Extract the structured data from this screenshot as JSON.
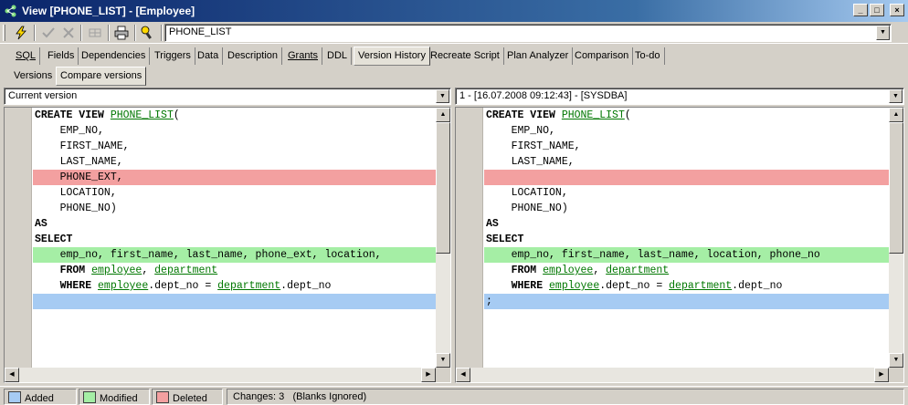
{
  "window": {
    "title": "View [PHONE_LIST] - [Employee]",
    "buttons": {
      "minimize": "_",
      "maximize": "□",
      "close": "×"
    }
  },
  "toolbar": {
    "object_name": "PHONE_LIST",
    "icons": [
      "compile-icon",
      "commit-icon",
      "rollback-icon",
      "grid-icon",
      "print-icon",
      "dependencies-icon"
    ]
  },
  "tabs": [
    {
      "label": "SQL",
      "underline": true
    },
    {
      "label": "Fields"
    },
    {
      "label": "Dependencies"
    },
    {
      "label": "Triggers"
    },
    {
      "label": "Data"
    },
    {
      "label": "Description"
    },
    {
      "label": "Grants",
      "underline": true
    },
    {
      "label": "DDL"
    },
    {
      "label": "Version History",
      "active": true
    },
    {
      "label": "Recreate Script"
    },
    {
      "label": "Plan Analyzer"
    },
    {
      "label": "Comparison"
    },
    {
      "label": "To-do"
    }
  ],
  "subtabs": [
    {
      "label": "Versions"
    },
    {
      "label": "Compare versions",
      "active": true
    }
  ],
  "left_pane": {
    "version": "Current version",
    "lines": [
      {
        "state": "",
        "tokens": [
          [
            "kw",
            "CREATE VIEW "
          ],
          [
            "id",
            "PHONE_LIST"
          ],
          [
            "",
            "("
          ]
        ]
      },
      {
        "state": "",
        "tokens": [
          [
            "",
            "    EMP_NO,"
          ]
        ]
      },
      {
        "state": "",
        "tokens": [
          [
            "",
            "    FIRST_NAME,"
          ]
        ]
      },
      {
        "state": "",
        "tokens": [
          [
            "",
            "    LAST_NAME,"
          ]
        ]
      },
      {
        "state": "del",
        "tokens": [
          [
            "",
            "    PHONE_EXT,"
          ]
        ]
      },
      {
        "state": "",
        "tokens": [
          [
            "",
            "    LOCATION,"
          ]
        ]
      },
      {
        "state": "",
        "tokens": [
          [
            "",
            "    PHONE_NO)"
          ]
        ]
      },
      {
        "state": "",
        "tokens": [
          [
            "kw",
            "AS"
          ]
        ]
      },
      {
        "state": "",
        "tokens": [
          [
            "kw",
            "SELECT"
          ]
        ]
      },
      {
        "state": "mod",
        "tokens": [
          [
            "",
            "    emp_no, first_name, last_name, phone_ext, location,"
          ]
        ]
      },
      {
        "state": "",
        "tokens": [
          [
            "kw",
            "    FROM "
          ],
          [
            "id",
            "employee"
          ],
          [
            "",
            ", "
          ],
          [
            "id",
            "department"
          ]
        ]
      },
      {
        "state": "",
        "tokens": [
          [
            "kw",
            "    WHERE "
          ],
          [
            "id",
            "employee"
          ],
          [
            "",
            ".dept_no = "
          ],
          [
            "id",
            "department"
          ],
          [
            "",
            ".dept_no"
          ]
        ]
      },
      {
        "state": "add",
        "tokens": [
          [
            "",
            ""
          ]
        ]
      }
    ]
  },
  "right_pane": {
    "version": "1 - [16.07.2008 09:12:43] - [SYSDBA]",
    "lines": [
      {
        "state": "",
        "tokens": [
          [
            "kw",
            "CREATE VIEW "
          ],
          [
            "id",
            "PHONE_LIST"
          ],
          [
            "",
            "("
          ]
        ]
      },
      {
        "state": "",
        "tokens": [
          [
            "",
            "    EMP_NO,"
          ]
        ]
      },
      {
        "state": "",
        "tokens": [
          [
            "",
            "    FIRST_NAME,"
          ]
        ]
      },
      {
        "state": "",
        "tokens": [
          [
            "",
            "    LAST_NAME,"
          ]
        ]
      },
      {
        "state": "del",
        "tokens": [
          [
            "",
            ""
          ]
        ]
      },
      {
        "state": "",
        "tokens": [
          [
            "",
            "    LOCATION,"
          ]
        ]
      },
      {
        "state": "",
        "tokens": [
          [
            "",
            "    PHONE_NO)"
          ]
        ]
      },
      {
        "state": "",
        "tokens": [
          [
            "kw",
            "AS"
          ]
        ]
      },
      {
        "state": "",
        "tokens": [
          [
            "kw",
            "SELECT"
          ]
        ]
      },
      {
        "state": "mod",
        "tokens": [
          [
            "",
            "    emp_no, first_name, last_name, location, phone_no"
          ]
        ]
      },
      {
        "state": "",
        "tokens": [
          [
            "kw",
            "    FROM "
          ],
          [
            "id",
            "employee"
          ],
          [
            "",
            ", "
          ],
          [
            "id",
            "department"
          ]
        ]
      },
      {
        "state": "",
        "tokens": [
          [
            "kw",
            "    WHERE "
          ],
          [
            "id",
            "employee"
          ],
          [
            "",
            ".dept_no = "
          ],
          [
            "id",
            "department"
          ],
          [
            "",
            ".dept_no"
          ]
        ]
      },
      {
        "state": "add",
        "tokens": [
          [
            "",
            ";"
          ]
        ]
      }
    ]
  },
  "legend": {
    "added": {
      "label": "Added",
      "color": "#a6cbf3"
    },
    "modified": {
      "label": "Modified",
      "color": "#a5eea5"
    },
    "deleted": {
      "label": "Deleted",
      "color": "#f3a0a0"
    }
  },
  "status": {
    "changes": "Changes: 3",
    "note": "(Blanks Ignored)"
  }
}
